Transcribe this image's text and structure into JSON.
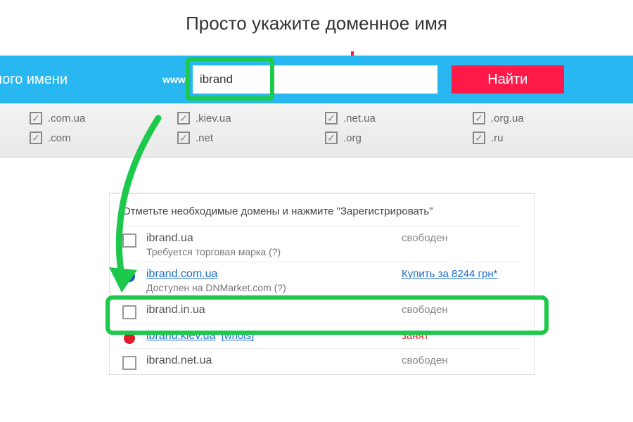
{
  "instruction": "Просто укажите доменное имя",
  "search": {
    "label_fragment": "енного имени",
    "www": "www",
    "value": "ibrand",
    "placeholder": "",
    "button": "Найти"
  },
  "tlds": [
    ".com.ua",
    ".kiev.ua",
    ".net.ua",
    ".org.ua",
    ".com",
    ".net",
    ".org",
    ".ru"
  ],
  "results": {
    "caption": "Отметьте необходимые домены и нажмите \"Зарегистрировать\"",
    "rows": [
      {
        "type": "chk",
        "domain": "ibrand.ua",
        "subtext": "Требуется торговая марка (?)",
        "status": "свободен",
        "status_kind": "free"
      },
      {
        "type": "dot-blue",
        "domain": "ibrand.com.ua",
        "domain_link": true,
        "subtext": "Доступен на DNMarket.com (?)",
        "status": "Купить за 8244 грн*",
        "status_kind": "buy"
      },
      {
        "type": "chk",
        "domain": "ibrand.in.ua",
        "status": "свободен",
        "status_kind": "free"
      },
      {
        "type": "dot-red",
        "domain": "ibrand.kiev.ua",
        "domain_link": true,
        "whois": "[whois]",
        "status": "занят",
        "status_kind": "busy"
      },
      {
        "type": "chk",
        "domain": "ibrand.net.ua",
        "status": "свободен",
        "status_kind": "free"
      }
    ]
  }
}
